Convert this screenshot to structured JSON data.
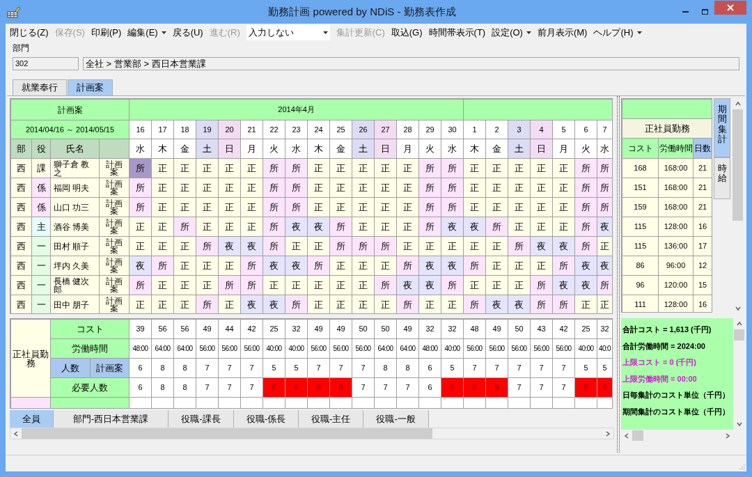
{
  "window": {
    "title": "勤務計画 powered by NDiS - 勤務表作成"
  },
  "menu": [
    {
      "kind": "command",
      "label": "閉じる(Z)",
      "disabled": false
    },
    {
      "kind": "command",
      "label": "保存(S)",
      "disabled": true
    },
    {
      "kind": "command",
      "label": "印刷(P)",
      "disabled": false
    },
    {
      "kind": "dropdown",
      "label": "編集(E)",
      "disabled": false
    },
    {
      "kind": "command",
      "label": "戻る(U)",
      "disabled": false
    },
    {
      "kind": "command",
      "label": "進む(R)",
      "disabled": true
    },
    {
      "kind": "select",
      "label": "入力しない",
      "disabled": false
    },
    {
      "kind": "command",
      "label": "集計更新(C)",
      "disabled": true
    },
    {
      "kind": "command",
      "label": "取込(G)",
      "disabled": false
    },
    {
      "kind": "command",
      "label": "時間帯表示(T)",
      "disabled": false
    },
    {
      "kind": "dropdown",
      "label": "設定(O)",
      "disabled": false
    },
    {
      "kind": "command",
      "label": "前月表示(M)",
      "disabled": false
    },
    {
      "kind": "dropdown",
      "label": "ヘルプ(H)",
      "disabled": false
    }
  ],
  "department": {
    "label": "部門",
    "code": "302",
    "path": "全社 > 営業部 > 西日本営業課"
  },
  "tabs": [
    {
      "label": "就業奉行",
      "selected": false
    },
    {
      "label": "計画案",
      "selected": true
    }
  ],
  "schedule": {
    "title": "計画案",
    "period": "2014/04/16 ～ 2014/05/15",
    "columns": [
      "部",
      "役",
      "氏名"
    ],
    "months": [
      {
        "label": "2014年4月",
        "days": [
          {
            "date": "16",
            "weekday": "水",
            "kind": "weekday"
          },
          {
            "date": "17",
            "weekday": "木",
            "kind": "weekday"
          },
          {
            "date": "18",
            "weekday": "金",
            "kind": "weekday"
          },
          {
            "date": "19",
            "weekday": "土",
            "kind": "saturday"
          },
          {
            "date": "20",
            "weekday": "日",
            "kind": "sunday"
          },
          {
            "date": "21",
            "weekday": "月",
            "kind": "weekday"
          },
          {
            "date": "22",
            "weekday": "火",
            "kind": "weekday"
          },
          {
            "date": "23",
            "weekday": "水",
            "kind": "weekday"
          },
          {
            "date": "24",
            "weekday": "木",
            "kind": "weekday"
          },
          {
            "date": "25",
            "weekday": "金",
            "kind": "weekday"
          },
          {
            "date": "26",
            "weekday": "土",
            "kind": "saturday"
          },
          {
            "date": "27",
            "weekday": "日",
            "kind": "sunday"
          },
          {
            "date": "28",
            "weekday": "月",
            "kind": "weekday"
          },
          {
            "date": "29",
            "weekday": "火",
            "kind": "weekday"
          },
          {
            "date": "30",
            "weekday": "水",
            "kind": "weekday"
          }
        ]
      },
      {
        "days": [
          {
            "date": "1",
            "weekday": "木",
            "kind": "weekday"
          },
          {
            "date": "2",
            "weekday": "金",
            "kind": "weekday"
          },
          {
            "date": "3",
            "weekday": "土",
            "kind": "saturday"
          },
          {
            "date": "4",
            "weekday": "日",
            "kind": "sunday"
          },
          {
            "date": "5",
            "weekday": "月",
            "kind": "weekday"
          },
          {
            "date": "6",
            "weekday": "火",
            "kind": "weekday"
          },
          {
            "date": "7",
            "weekday": "水",
            "kind": "weekday"
          }
        ]
      }
    ],
    "employees": [
      {
        "dept": "西",
        "role": "課",
        "color": "#ffffe8",
        "name": "獅子倉 教之",
        "plan": "計画案",
        "shifts": [
          {
            "text": "所",
            "kind": "office",
            "selected": true
          },
          {
            "text": "正",
            "kind": "day",
            "selected": false
          },
          {
            "text": "正",
            "kind": "day",
            "selected": false
          },
          {
            "text": "正",
            "kind": "day",
            "selected": false
          },
          {
            "text": "正",
            "kind": "day",
            "selected": false
          },
          {
            "text": "正",
            "kind": "day",
            "selected": false
          },
          {
            "text": "所",
            "kind": "office",
            "selected": false
          },
          {
            "text": "所",
            "kind": "office",
            "selected": false
          },
          {
            "text": "正",
            "kind": "day",
            "selected": false
          },
          {
            "text": "正",
            "kind": "day",
            "selected": false
          },
          {
            "text": "正",
            "kind": "day",
            "selected": false
          },
          {
            "text": "正",
            "kind": "day",
            "selected": false
          },
          {
            "text": "正",
            "kind": "day",
            "selected": false
          },
          {
            "text": "所",
            "kind": "office",
            "selected": false
          },
          {
            "text": "所",
            "kind": "office",
            "selected": false
          },
          {
            "text": "正",
            "kind": "day",
            "selected": false
          },
          {
            "text": "正",
            "kind": "day",
            "selected": false
          },
          {
            "text": "正",
            "kind": "day",
            "selected": false
          },
          {
            "text": "正",
            "kind": "day",
            "selected": false
          },
          {
            "text": "正",
            "kind": "day",
            "selected": false
          },
          {
            "text": "所",
            "kind": "office",
            "selected": false
          },
          {
            "text": "所",
            "kind": "office",
            "selected": false
          }
        ]
      },
      {
        "dept": "西",
        "role": "係",
        "color": "#fce4fc",
        "name": "福岡 明夫",
        "plan": "計画案",
        "shifts": [
          {
            "text": "所",
            "kind": "office",
            "selected": false
          },
          {
            "text": "正",
            "kind": "day",
            "selected": false
          },
          {
            "text": "正",
            "kind": "day",
            "selected": false
          },
          {
            "text": "正",
            "kind": "day",
            "selected": false
          },
          {
            "text": "正",
            "kind": "day",
            "selected": false
          },
          {
            "text": "正",
            "kind": "day",
            "selected": false
          },
          {
            "text": "所",
            "kind": "office",
            "selected": false
          },
          {
            "text": "所",
            "kind": "office",
            "selected": false
          },
          {
            "text": "正",
            "kind": "day",
            "selected": false
          },
          {
            "text": "正",
            "kind": "day",
            "selected": false
          },
          {
            "text": "正",
            "kind": "day",
            "selected": false
          },
          {
            "text": "正",
            "kind": "day",
            "selected": false
          },
          {
            "text": "正",
            "kind": "day",
            "selected": false
          },
          {
            "text": "所",
            "kind": "office",
            "selected": false
          },
          {
            "text": "所",
            "kind": "office",
            "selected": false
          },
          {
            "text": "正",
            "kind": "day",
            "selected": false
          },
          {
            "text": "正",
            "kind": "day",
            "selected": false
          },
          {
            "text": "正",
            "kind": "day",
            "selected": false
          },
          {
            "text": "正",
            "kind": "day",
            "selected": false
          },
          {
            "text": "正",
            "kind": "day",
            "selected": false
          },
          {
            "text": "所",
            "kind": "office",
            "selected": false
          },
          {
            "text": "所",
            "kind": "office",
            "selected": false
          }
        ]
      },
      {
        "dept": "西",
        "role": "係",
        "color": "#fce4fc",
        "name": "山口 功三",
        "plan": "計画案",
        "shifts": [
          {
            "text": "所",
            "kind": "office",
            "selected": false
          },
          {
            "text": "正",
            "kind": "day",
            "selected": false
          },
          {
            "text": "正",
            "kind": "day",
            "selected": false
          },
          {
            "text": "正",
            "kind": "day",
            "selected": false
          },
          {
            "text": "正",
            "kind": "day",
            "selected": false
          },
          {
            "text": "正",
            "kind": "day",
            "selected": false
          },
          {
            "text": "所",
            "kind": "office",
            "selected": false
          },
          {
            "text": "所",
            "kind": "office",
            "selected": false
          },
          {
            "text": "正",
            "kind": "day",
            "selected": false
          },
          {
            "text": "正",
            "kind": "day",
            "selected": false
          },
          {
            "text": "正",
            "kind": "day",
            "selected": false
          },
          {
            "text": "正",
            "kind": "day",
            "selected": false
          },
          {
            "text": "正",
            "kind": "day",
            "selected": false
          },
          {
            "text": "所",
            "kind": "office",
            "selected": false
          },
          {
            "text": "所",
            "kind": "office",
            "selected": false
          },
          {
            "text": "正",
            "kind": "day",
            "selected": false
          },
          {
            "text": "正",
            "kind": "day",
            "selected": false
          },
          {
            "text": "正",
            "kind": "day",
            "selected": false
          },
          {
            "text": "正",
            "kind": "day",
            "selected": false
          },
          {
            "text": "正",
            "kind": "day",
            "selected": false
          },
          {
            "text": "所",
            "kind": "office",
            "selected": false
          },
          {
            "text": "所",
            "kind": "office",
            "selected": false
          }
        ]
      },
      {
        "dept": "西",
        "role": "主",
        "color": "#e4fcfc",
        "name": "酒谷 博美",
        "plan": "計画案",
        "shifts": [
          {
            "text": "正",
            "kind": "day",
            "selected": false
          },
          {
            "text": "正",
            "kind": "day",
            "selected": false
          },
          {
            "text": "所",
            "kind": "office",
            "selected": false
          },
          {
            "text": "正",
            "kind": "day",
            "selected": false
          },
          {
            "text": "正",
            "kind": "day",
            "selected": false
          },
          {
            "text": "正",
            "kind": "day",
            "selected": false
          },
          {
            "text": "所",
            "kind": "office",
            "selected": false
          },
          {
            "text": "夜",
            "kind": "night",
            "selected": false
          },
          {
            "text": "夜",
            "kind": "night",
            "selected": false
          },
          {
            "text": "所",
            "kind": "office",
            "selected": false
          },
          {
            "text": "正",
            "kind": "day",
            "selected": false
          },
          {
            "text": "正",
            "kind": "day",
            "selected": false
          },
          {
            "text": "正",
            "kind": "day",
            "selected": false
          },
          {
            "text": "所",
            "kind": "office",
            "selected": false
          },
          {
            "text": "夜",
            "kind": "night",
            "selected": false
          },
          {
            "text": "夜",
            "kind": "night",
            "selected": false
          },
          {
            "text": "所",
            "kind": "office",
            "selected": false
          },
          {
            "text": "正",
            "kind": "day",
            "selected": false
          },
          {
            "text": "正",
            "kind": "day",
            "selected": false
          },
          {
            "text": "正",
            "kind": "day",
            "selected": false
          },
          {
            "text": "所",
            "kind": "office",
            "selected": false
          },
          {
            "text": "夜",
            "kind": "night",
            "selected": false
          }
        ]
      },
      {
        "dept": "西",
        "role": "一",
        "color": "#e4fce4",
        "name": "田村 順子",
        "plan": "計画案",
        "shifts": [
          {
            "text": "正",
            "kind": "day",
            "selected": false
          },
          {
            "text": "正",
            "kind": "day",
            "selected": false
          },
          {
            "text": "正",
            "kind": "day",
            "selected": false
          },
          {
            "text": "所",
            "kind": "office",
            "selected": false
          },
          {
            "text": "夜",
            "kind": "night",
            "selected": false
          },
          {
            "text": "夜",
            "kind": "night",
            "selected": false
          },
          {
            "text": "所",
            "kind": "office",
            "selected": false
          },
          {
            "text": "正",
            "kind": "day",
            "selected": false
          },
          {
            "text": "正",
            "kind": "day",
            "selected": false
          },
          {
            "text": "所",
            "kind": "office",
            "selected": false
          },
          {
            "text": "所",
            "kind": "office",
            "selected": false
          },
          {
            "text": "所",
            "kind": "office",
            "selected": false
          },
          {
            "text": "正",
            "kind": "day",
            "selected": false
          },
          {
            "text": "正",
            "kind": "day",
            "selected": false
          },
          {
            "text": "正",
            "kind": "day",
            "selected": false
          },
          {
            "text": "正",
            "kind": "day",
            "selected": false
          },
          {
            "text": "正",
            "kind": "day",
            "selected": false
          },
          {
            "text": "所",
            "kind": "office",
            "selected": false
          },
          {
            "text": "夜",
            "kind": "night",
            "selected": false
          },
          {
            "text": "夜",
            "kind": "night",
            "selected": false
          },
          {
            "text": "所",
            "kind": "office",
            "selected": false
          },
          {
            "text": "正",
            "kind": "day",
            "selected": false
          }
        ]
      },
      {
        "dept": "西",
        "role": "一",
        "color": "#e4fce4",
        "name": "坪内 久美",
        "plan": "計画案",
        "shifts": [
          {
            "text": "夜",
            "kind": "night",
            "selected": false
          },
          {
            "text": "所",
            "kind": "office",
            "selected": false
          },
          {
            "text": "正",
            "kind": "day",
            "selected": false
          },
          {
            "text": "正",
            "kind": "day",
            "selected": false
          },
          {
            "text": "正",
            "kind": "day",
            "selected": false
          },
          {
            "text": "所",
            "kind": "office",
            "selected": false
          },
          {
            "text": "夜",
            "kind": "night",
            "selected": false
          },
          {
            "text": "夜",
            "kind": "night",
            "selected": false
          },
          {
            "text": "所",
            "kind": "office",
            "selected": false
          },
          {
            "text": "正",
            "kind": "day",
            "selected": false
          },
          {
            "text": "正",
            "kind": "day",
            "selected": false
          },
          {
            "text": "正",
            "kind": "day",
            "selected": false
          },
          {
            "text": "所",
            "kind": "office",
            "selected": false
          },
          {
            "text": "夜",
            "kind": "night",
            "selected": false
          },
          {
            "text": "夜",
            "kind": "night",
            "selected": false
          },
          {
            "text": "所",
            "kind": "office",
            "selected": false
          },
          {
            "text": "正",
            "kind": "day",
            "selected": false
          },
          {
            "text": "正",
            "kind": "day",
            "selected": false
          },
          {
            "text": "正",
            "kind": "day",
            "selected": false
          },
          {
            "text": "所",
            "kind": "office",
            "selected": false
          },
          {
            "text": "夜",
            "kind": "night",
            "selected": false
          },
          {
            "text": "夜",
            "kind": "night",
            "selected": false
          }
        ]
      },
      {
        "dept": "西",
        "role": "一",
        "color": "#e4fce4",
        "name": "長橋 健次郎",
        "plan": "計画案",
        "shifts": [
          {
            "text": "所",
            "kind": "office",
            "selected": false
          },
          {
            "text": "正",
            "kind": "day",
            "selected": false
          },
          {
            "text": "正",
            "kind": "day",
            "selected": false
          },
          {
            "text": "正",
            "kind": "day",
            "selected": false
          },
          {
            "text": "所",
            "kind": "office",
            "selected": false
          },
          {
            "text": "所",
            "kind": "office",
            "selected": false
          },
          {
            "text": "正",
            "kind": "day",
            "selected": false
          },
          {
            "text": "正",
            "kind": "day",
            "selected": false
          },
          {
            "text": "正",
            "kind": "day",
            "selected": false
          },
          {
            "text": "正",
            "kind": "day",
            "selected": false
          },
          {
            "text": "正",
            "kind": "day",
            "selected": false
          },
          {
            "text": "所",
            "kind": "office",
            "selected": false
          },
          {
            "text": "夜",
            "kind": "night",
            "selected": false
          },
          {
            "text": "夜",
            "kind": "night",
            "selected": false
          },
          {
            "text": "所",
            "kind": "office",
            "selected": false
          },
          {
            "text": "正",
            "kind": "day",
            "selected": false
          },
          {
            "text": "正",
            "kind": "day",
            "selected": false
          },
          {
            "text": "正",
            "kind": "day",
            "selected": false
          },
          {
            "text": "所",
            "kind": "office",
            "selected": false
          },
          {
            "text": "夜",
            "kind": "night",
            "selected": false
          },
          {
            "text": "夜",
            "kind": "night",
            "selected": false
          },
          {
            "text": "所",
            "kind": "office",
            "selected": false
          }
        ]
      },
      {
        "dept": "西",
        "role": "一",
        "color": "#e4fce4",
        "name": "田中 朋子",
        "plan": "計画案",
        "shifts": [
          {
            "text": "正",
            "kind": "day",
            "selected": false
          },
          {
            "text": "正",
            "kind": "day",
            "selected": false
          },
          {
            "text": "正",
            "kind": "day",
            "selected": false
          },
          {
            "text": "所",
            "kind": "office",
            "selected": false
          },
          {
            "text": "正",
            "kind": "day",
            "selected": false
          },
          {
            "text": "夜",
            "kind": "night",
            "selected": false
          },
          {
            "text": "夜",
            "kind": "night",
            "selected": false
          },
          {
            "text": "所",
            "kind": "office",
            "selected": false
          },
          {
            "text": "正",
            "kind": "day",
            "selected": false
          },
          {
            "text": "正",
            "kind": "day",
            "selected": false
          },
          {
            "text": "正",
            "kind": "day",
            "selected": false
          },
          {
            "text": "正",
            "kind": "day",
            "selected": false
          },
          {
            "text": "所",
            "kind": "office",
            "selected": false
          },
          {
            "text": "正",
            "kind": "day",
            "selected": false
          },
          {
            "text": "正",
            "kind": "day",
            "selected": false
          },
          {
            "text": "所",
            "kind": "office",
            "selected": false
          },
          {
            "text": "夜",
            "kind": "night",
            "selected": false
          },
          {
            "text": "夜",
            "kind": "night",
            "selected": false
          },
          {
            "text": "所",
            "kind": "office",
            "selected": false
          },
          {
            "text": "所",
            "kind": "office",
            "selected": false
          },
          {
            "text": "正",
            "kind": "day",
            "selected": false
          },
          {
            "text": "正",
            "kind": "day",
            "selected": false
          }
        ]
      }
    ]
  },
  "daily_summary": {
    "group": "正社員勤務",
    "rows": [
      {
        "kind": "value",
        "label": "コスト",
        "values": [
          "39",
          "56",
          "56",
          "49",
          "44",
          "42",
          "25",
          "32",
          "49",
          "49",
          "50",
          "50",
          "49",
          "32",
          "32",
          "48",
          "49",
          "50",
          "43",
          "42",
          "25",
          "32"
        ]
      },
      {
        "kind": "time",
        "label": "労働時間",
        "values": [
          "48:00",
          "64:00",
          "64:00",
          "56:00",
          "56:00",
          "56:00",
          "40:00",
          "40:00",
          "56:00",
          "56:00",
          "56:00",
          "64:00",
          "64:00",
          "48:00",
          "40:00",
          "56:00",
          "56:00",
          "56:00",
          "56:00",
          "56:00",
          "40:00",
          "40:0"
        ]
      },
      {
        "kind": "split",
        "label": "人数",
        "sublabel": "計画案",
        "values": [
          "6",
          "8",
          "8",
          "7",
          "7",
          "7",
          "5",
          "5",
          "7",
          "7",
          "7",
          "8",
          "8",
          "6",
          "5",
          "7",
          "7",
          "7",
          "7",
          "7",
          "5",
          "5"
        ]
      },
      {
        "kind": "required",
        "label": "必要人数",
        "values": [
          {
            "text": "6",
            "shortage": false
          },
          {
            "text": "8",
            "shortage": false
          },
          {
            "text": "8",
            "shortage": false
          },
          {
            "text": "7",
            "shortage": false
          },
          {
            "text": "7",
            "shortage": false
          },
          {
            "text": "7",
            "shortage": false
          },
          {
            "text": "6",
            "shortage": true
          },
          {
            "text": "6",
            "shortage": true
          },
          {
            "text": "8",
            "shortage": true
          },
          {
            "text": "8",
            "shortage": true
          },
          {
            "text": "7",
            "shortage": false
          },
          {
            "text": "7",
            "shortage": false
          },
          {
            "text": "7",
            "shortage": false
          },
          {
            "text": "6",
            "shortage": false
          },
          {
            "text": "6",
            "shortage": true
          },
          {
            "text": "8",
            "shortage": true
          },
          {
            "text": "8",
            "shortage": true
          },
          {
            "text": "7",
            "shortage": false
          },
          {
            "text": "7",
            "shortage": false
          },
          {
            "text": "7",
            "shortage": false
          },
          {
            "text": "6",
            "shortage": true
          },
          {
            "text": "6",
            "shortage": true
          }
        ]
      },
      {
        "kind": "clipped"
      }
    ]
  },
  "filter_tabs": [
    {
      "label": "全員",
      "selected": true
    },
    {
      "label": "部門-西日本営業課",
      "selected": false
    },
    {
      "label": "役職-課長",
      "selected": false
    },
    {
      "label": "役職-係長",
      "selected": false
    },
    {
      "label": "役職-主任",
      "selected": false
    },
    {
      "label": "役職-一般",
      "selected": false
    }
  ],
  "period_summary": {
    "group": "正社員勤務",
    "columns": [
      {
        "label": "コスト",
        "kind": "green"
      },
      {
        "label": "労働時間",
        "kind": "green"
      },
      {
        "label": "日数",
        "kind": "blue"
      }
    ],
    "rows": [
      [
        "168",
        "168:00",
        "21"
      ],
      [
        "151",
        "168:00",
        "21"
      ],
      [
        "159",
        "168:00",
        "21"
      ],
      [
        "115",
        "128:00",
        "16"
      ],
      [
        "115",
        "136:00",
        "17"
      ],
      [
        "86",
        "96:00",
        "12"
      ],
      [
        "96",
        "120:00",
        "15"
      ],
      [
        "111",
        "128:00",
        "16"
      ]
    ]
  },
  "side_tabs": [
    {
      "label": "期間集計",
      "selected": true
    },
    {
      "label": "時給",
      "selected": false
    }
  ],
  "totals": [
    {
      "text": "合計コスト = 1,613 (千円)",
      "color": "#000000"
    },
    {
      "text": "合計労働時間 = 2024:00",
      "color": "#000000"
    },
    {
      "text": "上限コスト = 0 (千円)",
      "color": "#d020d0"
    },
    {
      "text": "上限労働時間 = 00:00",
      "color": "#d020d0"
    },
    {
      "text": "日毎集計のコスト単位（千円）",
      "color": "#000000"
    },
    {
      "text": "期間集計のコスト単位（千円）",
      "color": "#000000"
    }
  ]
}
